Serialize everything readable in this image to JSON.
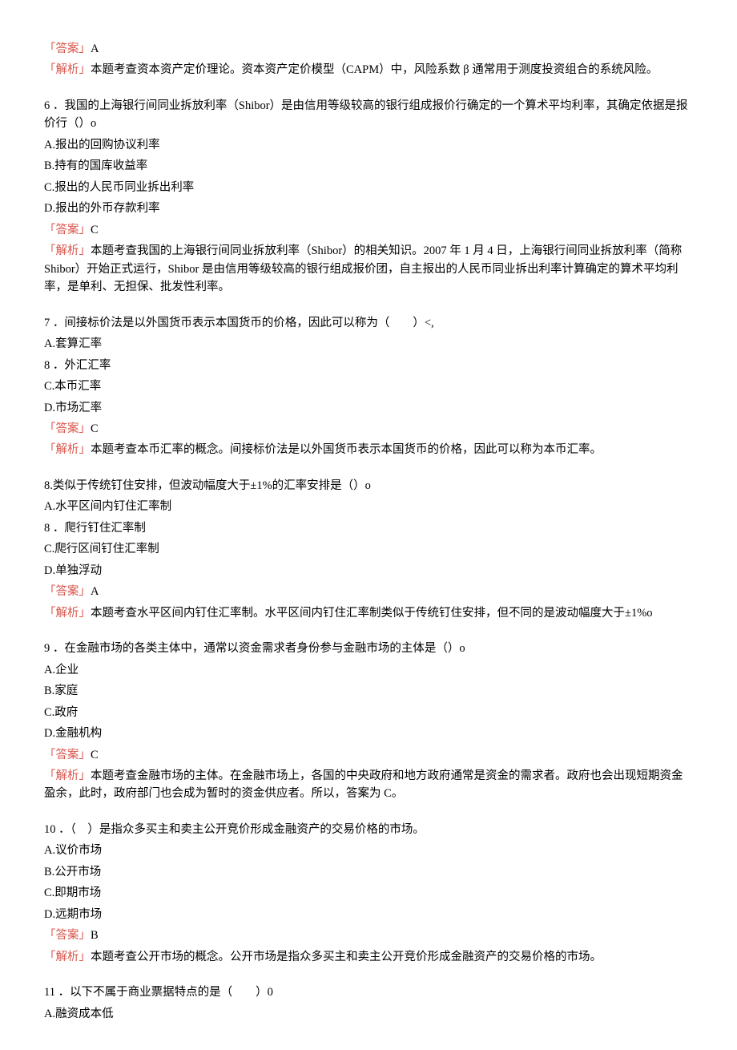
{
  "q5": {
    "answer_label": "「答案」",
    "answer_val": "A",
    "analysis_label": "「解析」",
    "analysis_text": "本题考查资本资产定价理论。资本资产定价模型（CAPM）中，风险系数 β 通常用于测度投资组合的系统风险。"
  },
  "q6": {
    "stem": "6 ．我国的上海银行间同业拆放利率（Shibor）是由信用等级较高的银行组成报价行确定的一个算术平均利率，其确定依据是报价行（）o",
    "optA": "A.报出的回购协议利率",
    "optB": "B.持有的国库收益率",
    "optC": "C.报出的人民币同业拆出利率",
    "optD": "D.报出的外币存款利率",
    "answer_label": "「答案」",
    "answer_val": "C",
    "analysis_label": "「解析」",
    "analysis_text": "本题考查我国的上海银行间同业拆放利率（Shibor）的相关知识。2007 年 1 月 4 日，上海银行间同业拆放利率（简称 Shibor）开始正式运行，Shibor 是由信用等级较高的银行组成报价团，自主报出的人民币同业拆出利率计算确定的算术平均利率，是单利、无担保、批发性利率。"
  },
  "q7": {
    "stem": "7 ．间接标价法是以外国货币表示本国货币的价格，因此可以称为（　　）<,",
    "optA": "A.套算汇率",
    "opt8": "8 ．外汇汇率",
    "optC": "C.本币汇率",
    "optD": "D.市场汇率",
    "answer_label": "「答案」",
    "answer_val": "C",
    "analysis_label": "「解析」",
    "analysis_text": "本题考查本币汇率的概念。间接标价法是以外国货币表示本国货币的价格，因此可以称为本币汇率。"
  },
  "q8": {
    "stem": "8.类似于传统钉住安排，但波动幅度大于±1%的汇率安排是（）o",
    "optA": "A.水平区间内钉住汇率制",
    "opt8": "8 ．爬行钉住汇率制",
    "optC": "C.爬行区间钉住汇率制",
    "optD": "D.单独浮动",
    "answer_label": "「答案」",
    "answer_val": "A",
    "analysis_label": "「解析」",
    "analysis_text": "本题考查水平区间内钉住汇率制。水平区间内钉住汇率制类似于传统钉住安排，但不同的是波动幅度大于±1%o"
  },
  "q9": {
    "stem": "9 ．在金融市场的各类主体中，通常以资金需求者身份参与金融市场的主体是（）o",
    "optA": "A.企业",
    "optB": "B.家庭",
    "optC": "C.政府",
    "optD": "D.金融机构",
    "answer_label": "「答案」",
    "answer_val": "C",
    "analysis_label": "「解析」",
    "analysis_text": "本题考查金融市场的主体。在金融市场上，各国的中央政府和地方政府通常是资金的需求者。政府也会出现短期资金盈余，此时，政府部门也会成为暂时的资金供应者。所以，答案为 C。"
  },
  "q10": {
    "stem": "10 ．（　）是指众多买主和卖主公开竞价形成金融资产的交易价格的市场。",
    "optA": "A.议价市场",
    "optB": "B.公开市场",
    "optC": "C.即期市场",
    "optD": "D.远期市场",
    "answer_label": "「答案」",
    "answer_val": "B",
    "analysis_label": "「解析」",
    "analysis_text": "本题考查公开市场的概念。公开市场是指众多买主和卖主公开竞价形成金融资产的交易价格的市场。"
  },
  "q11": {
    "stem": "11 ．以下不属于商业票据特点的是（　　）0",
    "optA": "A.融资成本低"
  }
}
